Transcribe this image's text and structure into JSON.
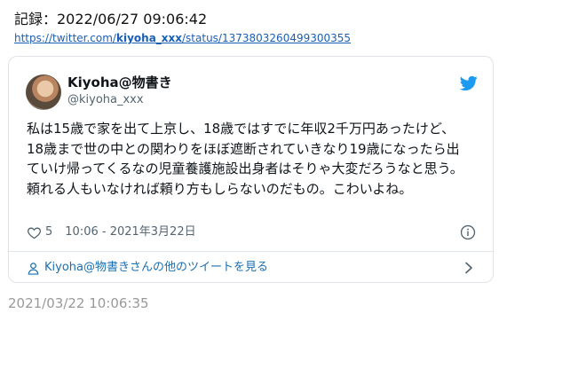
{
  "record": {
    "label": "記録：2022/06/27 09:06:42",
    "url_prefix": "https://twitter.com/",
    "url_user": "kiyoha_xxx",
    "url_suffix": "/status/1373803260499300355"
  },
  "tweet": {
    "author_name": "Kiyoha@物書き",
    "author_handle": "@kiyoha_xxx",
    "text": "私は15歳で家を出て上京し、18歳ではすでに年収2千万円あったけど、18歳まで世の中との関わりをほぼ遮断されていきなり19歳になったら出ていけ帰ってくるなの児童養護施設出身者はそりゃ大変だろうなと思う。頼れる人もいなければ頼り方もしらないのだもの。こわいよね。",
    "likes": "5",
    "timestamp": "10:06 - 2021年3月22日",
    "more_link": "Kiyoha@物書きさんの他のツイートを見る"
  },
  "archived_time": "2021/03/22 10:06:35",
  "colors": {
    "twitter_blue": "#1d9bf0",
    "link_blue": "#1a5fb4",
    "muted_gray": "#536471"
  },
  "icons": {
    "bird": "twitter-bird-icon",
    "heart": "heart-icon",
    "info": "info-icon",
    "person": "person-icon",
    "chevron": "chevron-right-icon"
  }
}
